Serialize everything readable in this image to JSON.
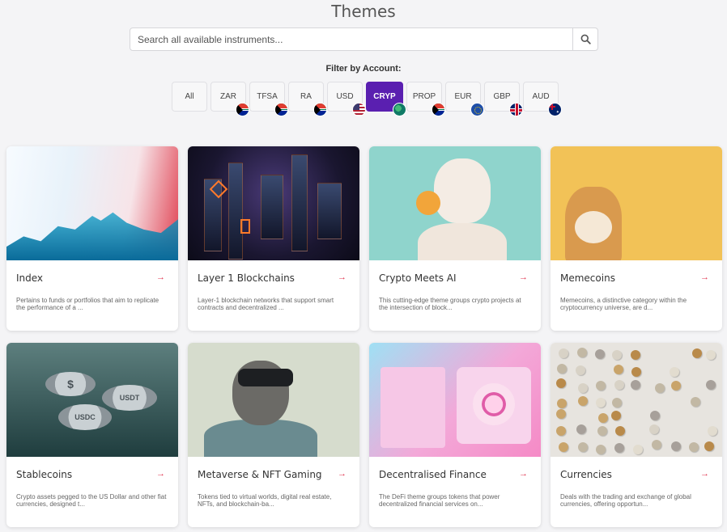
{
  "page": {
    "title": "Themes"
  },
  "search": {
    "placeholder": "Search all available instruments..."
  },
  "filter": {
    "label": "Filter by Account:",
    "accounts": [
      {
        "label": "All",
        "flag": ""
      },
      {
        "label": "ZAR",
        "flag": "za-flag-icon"
      },
      {
        "label": "TFSA",
        "flag": "za-flag-icon"
      },
      {
        "label": "RA",
        "flag": "za-flag-icon"
      },
      {
        "label": "USD",
        "flag": "us-flag-icon"
      },
      {
        "label": "CRYP",
        "flag": "globe-icon",
        "active": true
      },
      {
        "label": "PROP",
        "flag": "za-flag-icon"
      },
      {
        "label": "EUR",
        "flag": "eu-flag-icon"
      },
      {
        "label": "GBP",
        "flag": "gb-flag-icon"
      },
      {
        "label": "AUD",
        "flag": "au-flag-icon"
      }
    ],
    "active_color": "#5a1fb0"
  },
  "themes": [
    {
      "title": "Index",
      "desc": "Pertains to funds or portfolios that aim to replicate the performance of a ..."
    },
    {
      "title": "Layer 1 Blockchains",
      "desc": "Layer-1 blockchain networks that support smart contracts and decentralized ..."
    },
    {
      "title": "Crypto Meets AI",
      "desc": "This cutting-edge theme groups crypto projects at the intersection of block..."
    },
    {
      "title": "Memecoins",
      "desc": "Memecoins, a distinctive category within the cryptocurrency universe, are d..."
    },
    {
      "title": "Stablecoins",
      "desc": "Crypto assets pegged to the US Dollar and other fiat currencies, designed t..."
    },
    {
      "title": "Metaverse & NFT Gaming",
      "desc": "Tokens tied to virtual worlds, digital real estate, NFTs, and blockchain-ba..."
    },
    {
      "title": "Decentralised Finance",
      "desc": "The DeFi theme groups tokens that power decentralized financial services on..."
    },
    {
      "title": "Currencies",
      "desc": "Deals with the trading and exchange of global currencies, offering opportun..."
    }
  ],
  "coins": {
    "usdt": "USDT",
    "usdc": "USDC",
    "usd": "$"
  },
  "arrow": "→",
  "accent_color": "#e0344f"
}
